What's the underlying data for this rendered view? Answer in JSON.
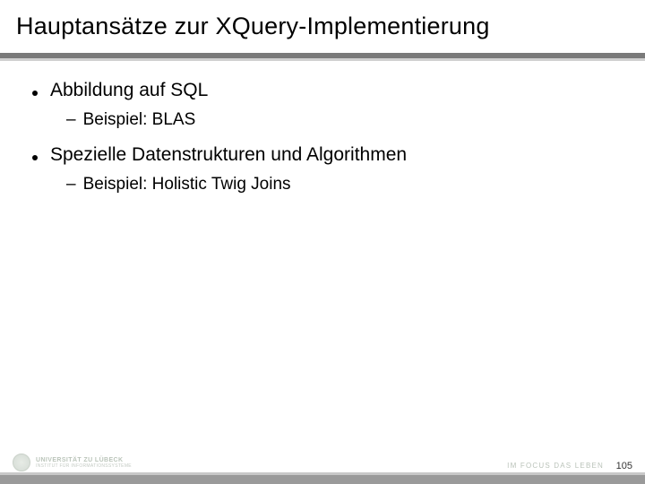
{
  "title": "Hauptansätze zur XQuery-Implementierung",
  "bullets": [
    {
      "text": "Abbildung auf SQL",
      "sub": "Beispiel: BLAS"
    },
    {
      "text": "Spezielle Datenstrukturen und Algorithmen",
      "sub": "Beispiel: Holistic Twig Joins"
    }
  ],
  "footer": {
    "university_line1": "UNIVERSITÄT ZU LÜBECK",
    "university_line2": "INSTITUT FÜR INFORMATIONSSYSTEME",
    "tagline": "IM FOCUS DAS LEBEN",
    "page": "105"
  }
}
